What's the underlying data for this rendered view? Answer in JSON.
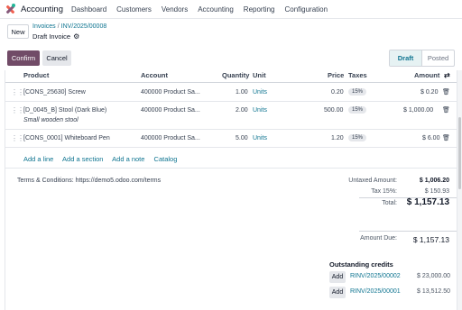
{
  "navbar": {
    "app_name": "Accounting",
    "items": [
      "Dashboard",
      "Customers",
      "Vendors",
      "Accounting",
      "Reporting",
      "Configuration"
    ]
  },
  "control_panel": {
    "new_label": "New",
    "breadcrumb_root": "Invoices",
    "breadcrumb_sep": "/",
    "breadcrumb_current": "INV/2025/00008",
    "record_name": "Draft Invoice"
  },
  "actions": {
    "confirm": "Confirm",
    "cancel": "Cancel"
  },
  "statusbar": {
    "steps": [
      "Draft",
      "Posted"
    ],
    "active": "Draft"
  },
  "lines": {
    "headers": {
      "product": "Product",
      "account": "Account",
      "quantity": "Quantity",
      "unit": "Unit",
      "price": "Price",
      "taxes": "Taxes",
      "amount": "Amount"
    },
    "rows": [
      {
        "product": "[CONS_25630] Screw",
        "account": "400000 Product Sa...",
        "quantity": "1.00",
        "unit": "Units",
        "price": "0.20",
        "tax": "15%",
        "amount": "$ 0.20",
        "description": ""
      },
      {
        "product": "[D_0045_B] Stool (Dark Blue)",
        "account": "400000 Product Sa...",
        "quantity": "2.00",
        "unit": "Units",
        "price": "500.00",
        "tax": "15%",
        "amount": "$ 1,000.00",
        "description": "Small wooden stool"
      },
      {
        "product": "[CONS_0001] Whiteboard Pen",
        "account": "400000 Product Sa...",
        "quantity": "5.00",
        "unit": "Units",
        "price": "1.20",
        "tax": "15%",
        "amount": "$ 6.00",
        "description": ""
      }
    ],
    "add_links": [
      "Add a line",
      "Add a section",
      "Add a note",
      "Catalog"
    ]
  },
  "terms": "Terms & Conditions: https://demo5.odoo.com/terms",
  "totals": {
    "untaxed_label": "Untaxed Amount:",
    "untaxed_value": "$ 1,006.20",
    "tax_label": "Tax 15%:",
    "tax_value": "$ 150.93",
    "total_label": "Total:",
    "total_value": "$ 1,157.13",
    "amount_due_label": "Amount Due:",
    "amount_due_value": "$ 1,157.13"
  },
  "outstanding": {
    "title": "Outstanding credits",
    "add_label": "Add",
    "credits": [
      {
        "ref": "RINV/2025/00002",
        "amount": "$ 23,000.00"
      },
      {
        "ref": "RINV/2025/00001",
        "amount": "$ 13,512.50"
      }
    ]
  },
  "colors": {
    "brand": "#714b67",
    "link": "#0e7490"
  }
}
